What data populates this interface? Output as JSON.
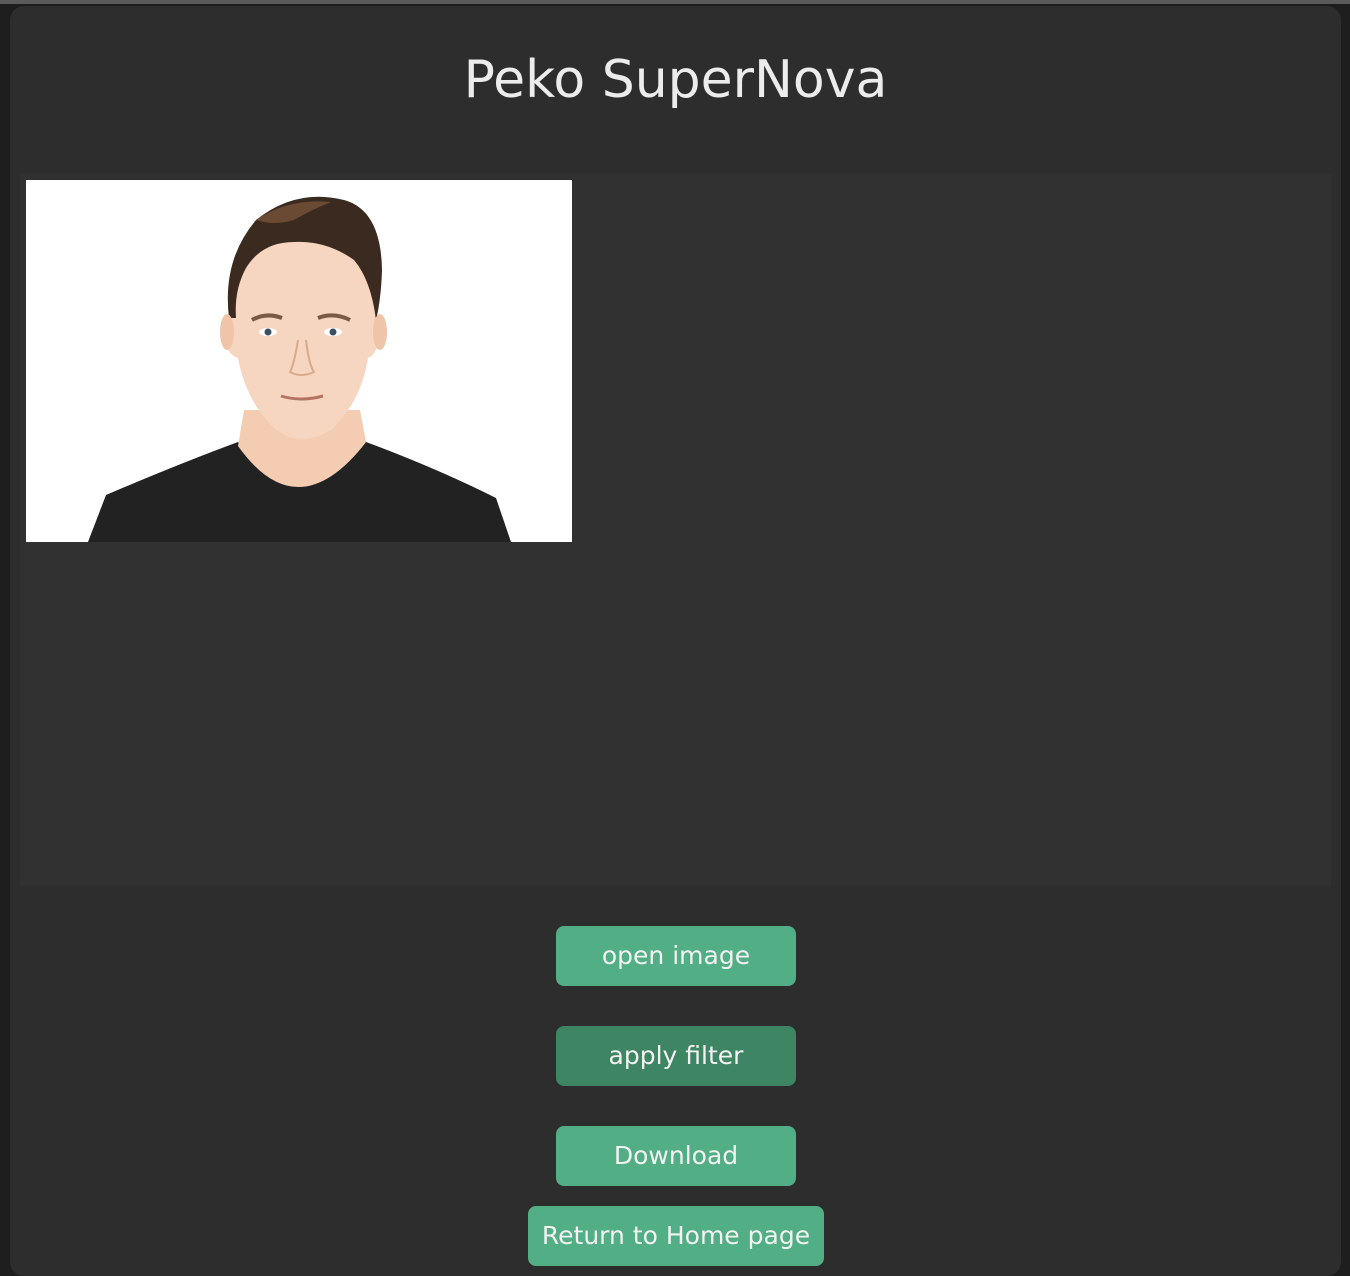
{
  "app": {
    "title": "Peko SuperNova"
  },
  "image_view": {
    "image_description": "portrait-photo"
  },
  "buttons": {
    "open_image": "open image",
    "apply_filter": "apply filter",
    "download": "Download",
    "return_home": "Return to Home page"
  },
  "colors": {
    "button": "#52ae84",
    "button_active": "#3e8563",
    "window_bg": "#2d2d2d",
    "canvas_bg": "#313131"
  }
}
